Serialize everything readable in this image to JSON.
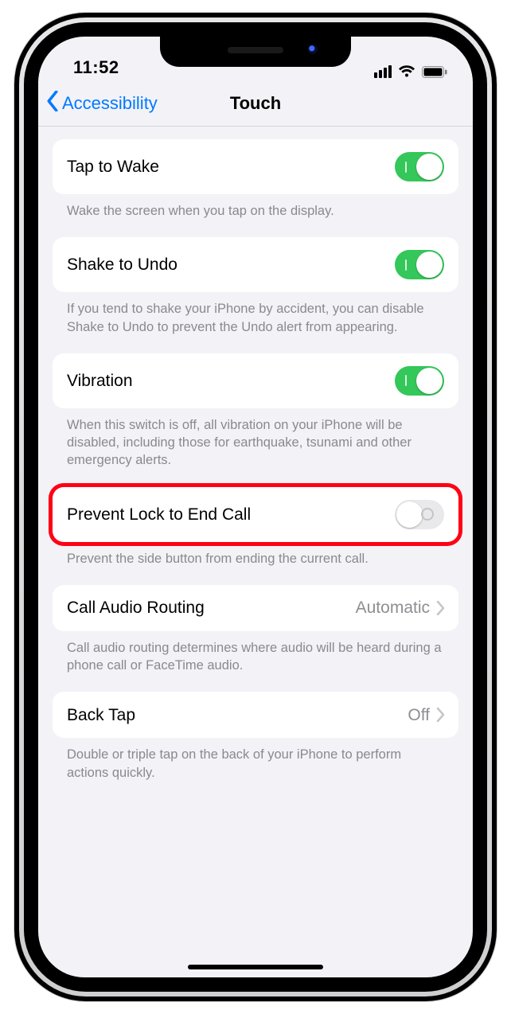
{
  "status": {
    "time": "11:52"
  },
  "nav": {
    "back_label": "Accessibility",
    "title": "Touch"
  },
  "groups": {
    "tap_to_wake": {
      "label": "Tap to Wake",
      "on": true,
      "footer": "Wake the screen when you tap on the display."
    },
    "shake_to_undo": {
      "label": "Shake to Undo",
      "on": true,
      "footer": "If you tend to shake your iPhone by accident, you can disable Shake to Undo to prevent the Undo alert from appearing."
    },
    "vibration": {
      "label": "Vibration",
      "on": true,
      "footer": "When this switch is off, all vibration on your iPhone will be disabled, including those for earthquake, tsunami and other emergency alerts."
    },
    "prevent_lock_end_call": {
      "label": "Prevent Lock to End Call",
      "on": false,
      "footer": "Prevent the side button from ending the current call.",
      "highlighted": true
    },
    "call_audio_routing": {
      "label": "Call Audio Routing",
      "value": "Automatic",
      "footer": "Call audio routing determines where audio will be heard during a phone call or FaceTime audio."
    },
    "back_tap": {
      "label": "Back Tap",
      "value": "Off",
      "footer": "Double or triple tap on the back of your iPhone to perform actions quickly."
    }
  },
  "highlight_color": "#ff0015"
}
